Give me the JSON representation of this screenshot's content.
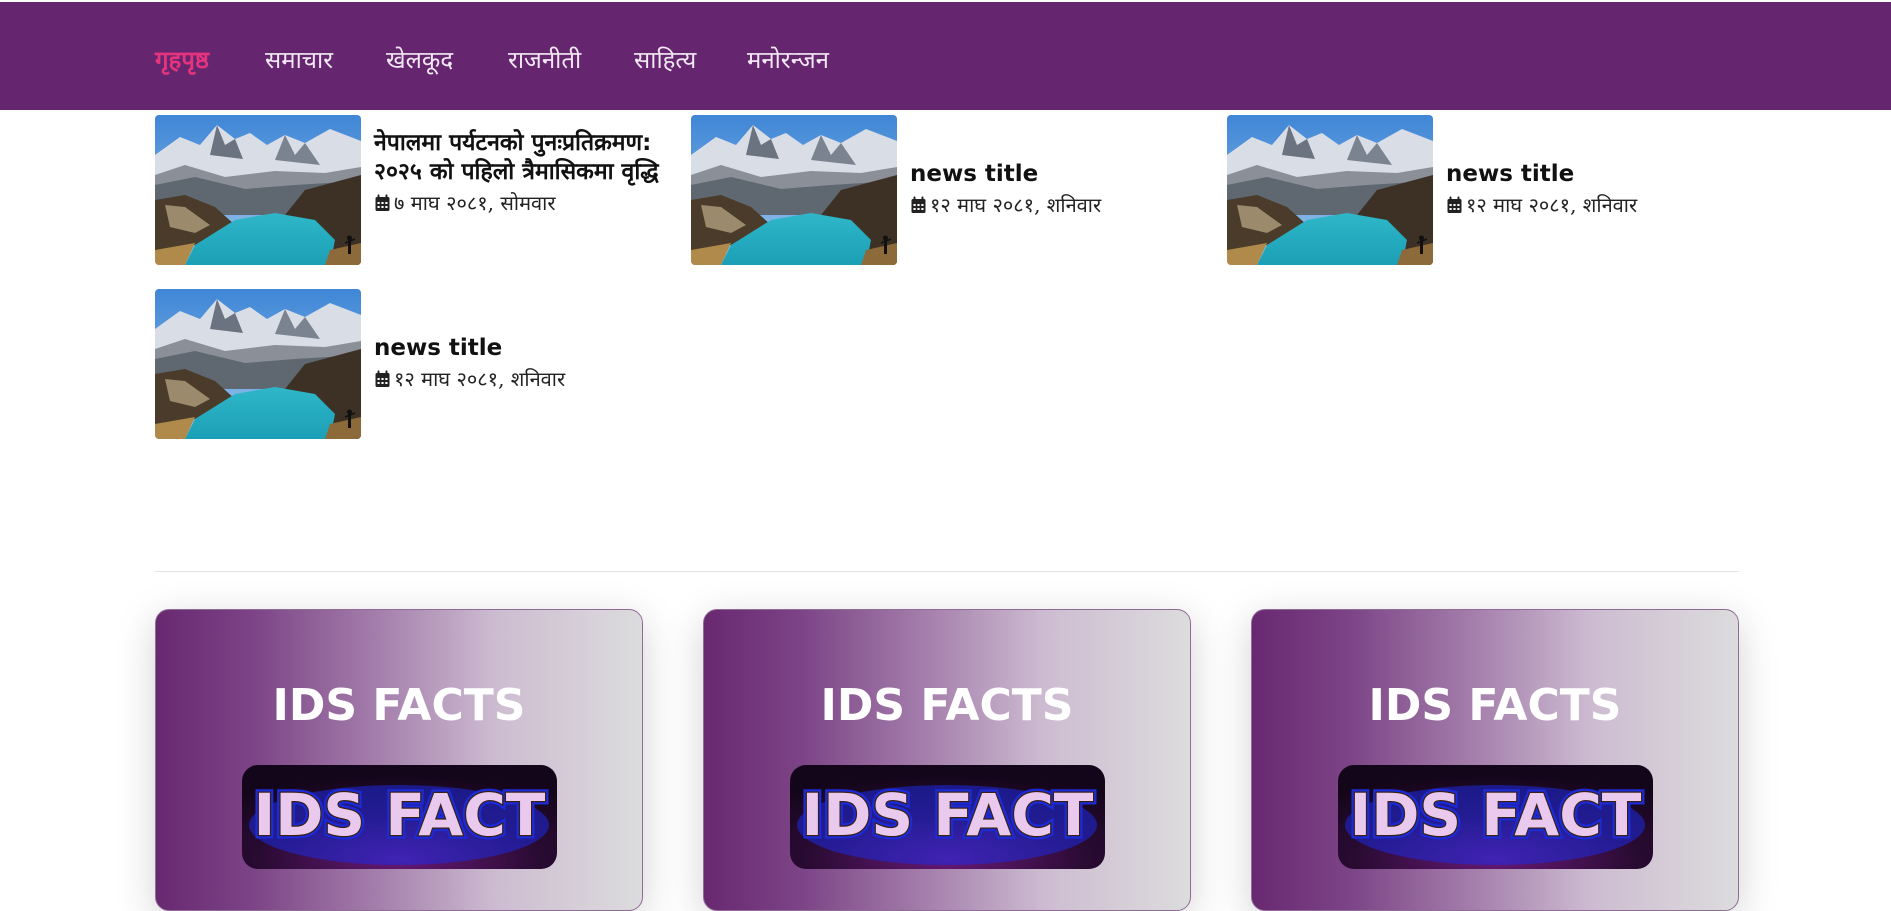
{
  "nav": {
    "items": [
      {
        "label": "गृहपृष्ठ",
        "active": true
      },
      {
        "label": "समाचार",
        "active": false
      },
      {
        "label": "खेलकूद",
        "active": false
      },
      {
        "label": "राजनीती",
        "active": false
      },
      {
        "label": "साहित्य",
        "active": false
      },
      {
        "label": "मनोरन्जन",
        "active": false
      }
    ]
  },
  "news": [
    {
      "title": "नेपालमा पर्यटनको पुनःप्रतिक्रमण: २०२५ को पहिलो त्रैमासिकमा वृद्धि",
      "date": "७ माघ २०८१, सोमवार",
      "image": "mountain-lake-photo"
    },
    {
      "title": "news title",
      "date": "१२ माघ २०८१, शनिवार",
      "image": "mountain-lake-photo"
    },
    {
      "title": "news title",
      "date": "१२ माघ २०८१, शनिवार",
      "image": "mountain-lake-photo"
    },
    {
      "title": "news title",
      "date": "१२ माघ २०८१, शनिवार",
      "image": "mountain-lake-photo"
    }
  ],
  "facts": [
    {
      "heading": "IDS FACTS",
      "banner_text": "IDS FACT"
    },
    {
      "heading": "IDS FACTS",
      "banner_text": "IDS FACT"
    },
    {
      "heading": "IDS FACTS",
      "banner_text": "IDS FACT"
    }
  ],
  "colors": {
    "navbar": "#65256f",
    "nav_active": "#e5337d",
    "nav_text": "#f1e8f3",
    "card_gradient_start": "#682870",
    "card_gradient_end": "#dcdcdd"
  },
  "icons": {
    "date": "calendar-icon"
  }
}
